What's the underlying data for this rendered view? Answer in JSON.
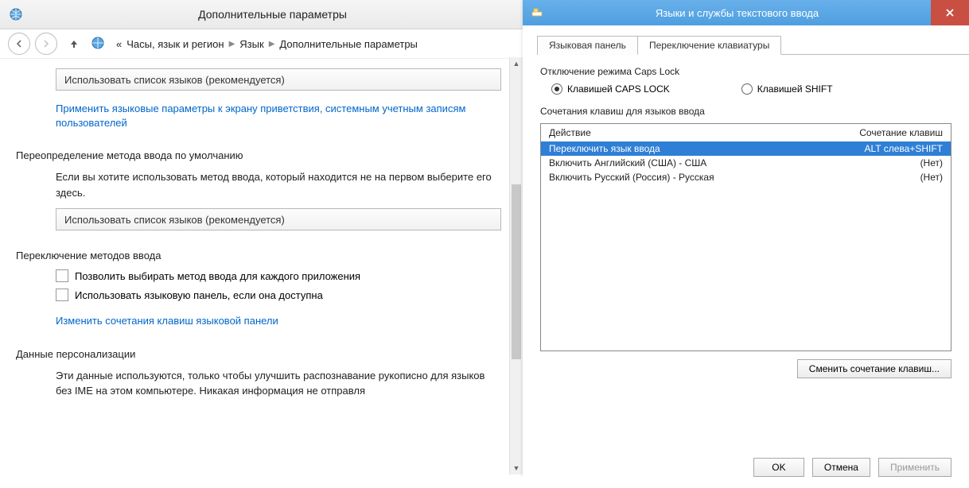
{
  "left": {
    "title": "Дополнительные параметры",
    "breadcrumb": {
      "prefix": "«",
      "c1": "Часы, язык и регион",
      "c2": "Язык",
      "c3": "Дополнительные параметры"
    },
    "combo1": "Использовать список языков (рекомендуется)",
    "link1": "Применить языковые параметры к экрану приветствия, системным учетным записям пользователей",
    "section1": "Переопределение метода ввода по умолчанию",
    "text1": "Если вы хотите использовать метод ввода, который находится не на первом выберите его здесь.",
    "combo2": "Использовать список языков (рекомендуется)",
    "section2": "Переключение методов ввода",
    "check1": "Позволить выбирать метод ввода для каждого приложения",
    "check2": "Использовать языковую панель, если она доступна",
    "link2": "Изменить сочетания клавиш языковой панели",
    "section3": "Данные персонализации",
    "text3": "Эти данные используются, только чтобы улучшить распознавание рукописно для языков без IME на этом компьютере. Никакая информация не отправля"
  },
  "right": {
    "title": "Языки и службы текстового ввода",
    "tabs": {
      "t1": "Языковая панель",
      "t2": "Переключение клавиатуры"
    },
    "capslock_label": "Отключение режима Caps Lock",
    "radio1": "Клавишей CAPS LOCK",
    "radio2": "Клавишей SHIFT",
    "hotkeys_label": "Сочетания клавиш для языков ввода",
    "head_action": "Действие",
    "head_keys": "Сочетание клавиш",
    "rows": [
      {
        "action": "Переключить язык ввода",
        "keys": "ALT слева+SHIFT"
      },
      {
        "action": "Включить Английский (США) - США",
        "keys": "(Нет)"
      },
      {
        "action": "Включить Русский (Россия) - Русская",
        "keys": "(Нет)"
      }
    ],
    "change_btn": "Сменить сочетание клавиш...",
    "ok": "OK",
    "cancel": "Отмена",
    "apply": "Применить"
  }
}
